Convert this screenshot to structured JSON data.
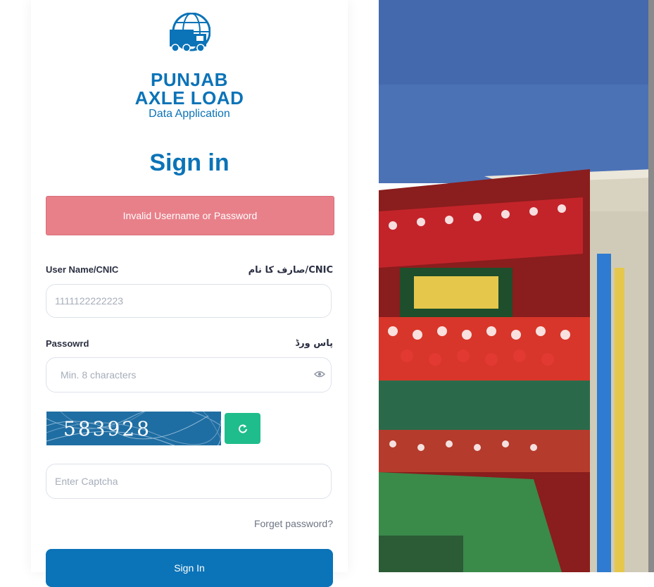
{
  "brand": {
    "title_line1": "PUNJAB",
    "title_line2": "AXLE LOAD",
    "subtitle": "Data Application",
    "logo_icon": "truck-globe-icon"
  },
  "signin": {
    "title": "Sign in"
  },
  "alert": {
    "message": "Invalid Username or Password",
    "color": "#e8808a"
  },
  "form": {
    "username": {
      "label": "User Name/CNIC",
      "label_urdu": "CNIC/صارف کا نام",
      "value": "",
      "placeholder": "1111122222223"
    },
    "password": {
      "label": "Passowrd",
      "label_urdu": "پاس ورڈ",
      "value": "",
      "placeholder": "Min. 8 characters",
      "toggle_icon": "eye-icon"
    },
    "captcha": {
      "code": "583928",
      "input_placeholder": "Enter Captcha",
      "refresh_icon": "refresh-icon"
    },
    "forgot_label": "Forget password?",
    "submit_label": "Sign In"
  },
  "colors": {
    "primary": "#0b73b7",
    "accent_green": "#1fbd8b",
    "alert": "#e8808a"
  }
}
